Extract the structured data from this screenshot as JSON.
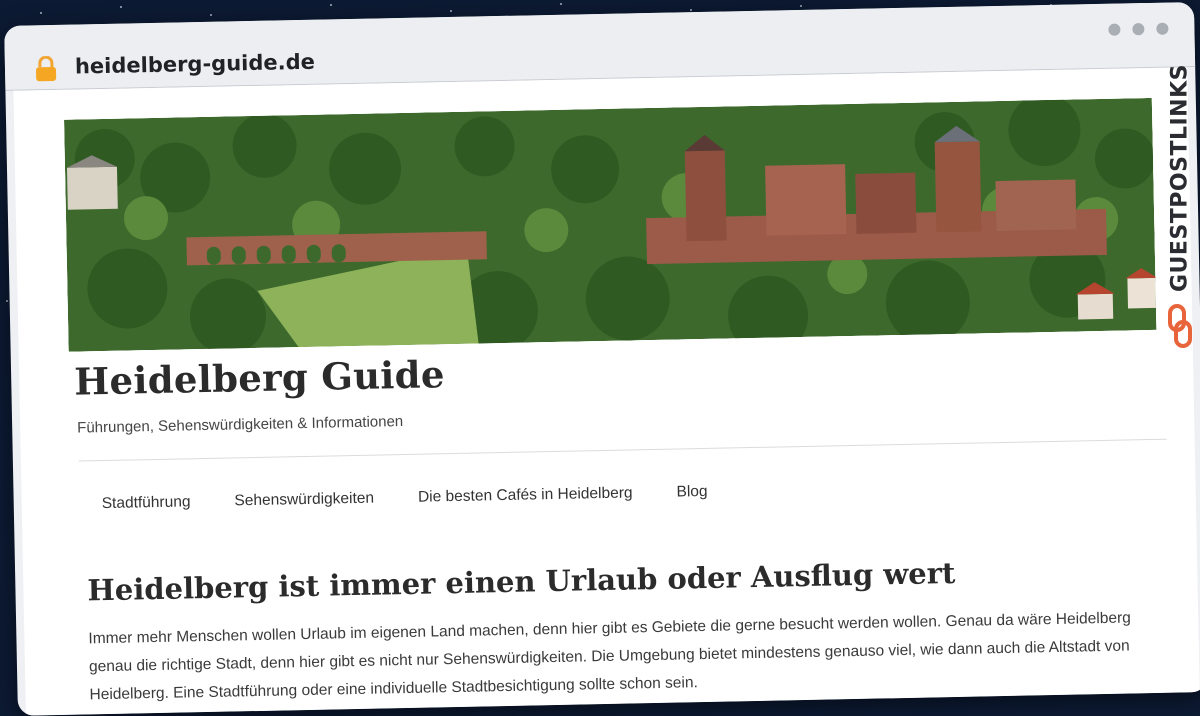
{
  "browser": {
    "url": "heidelberg-guide.de"
  },
  "site": {
    "title": "Heidelberg Guide",
    "tagline": "Führungen, Sehenswürdigkeiten & Informationen"
  },
  "nav": {
    "items": [
      {
        "label": "Stadtführung"
      },
      {
        "label": "Sehenswürdigkeiten"
      },
      {
        "label": "Die besten Cafés in Heidelberg"
      },
      {
        "label": "Blog"
      }
    ]
  },
  "article": {
    "headline": "Heidelberg ist immer einen Urlaub oder Ausflug wert",
    "lines": [
      "Immer mehr Menschen wollen Urlaub im eigenen Land machen, denn hier gibt es Gebiete die gerne besucht werden wollen. Genau da wäre Heidelberg",
      "genau die richtige Stadt, denn hier gibt es nicht nur Sehenswürdigkeiten. Die Umgebung bietet mindestens genauso viel, wie dann auch die Altstadt von",
      "Heidelberg. Eine Stadtführung oder eine individuelle Stadtbesichtigung sollte schon sein."
    ]
  },
  "brand": {
    "name": "GUESTPOSTLINKS",
    "accent": "#e8643a"
  },
  "icons": {
    "lock": "lock-icon",
    "window_dots": "window-control-dots"
  }
}
